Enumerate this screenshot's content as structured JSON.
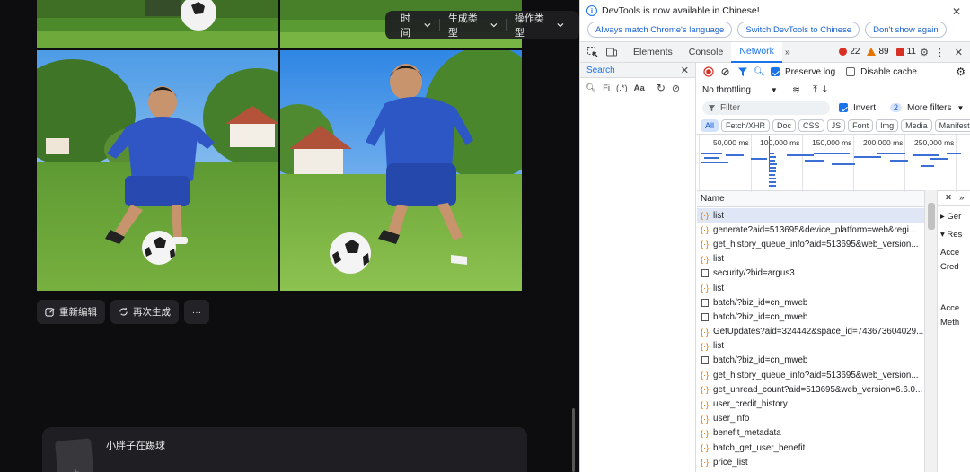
{
  "app": {
    "filters": [
      {
        "label": "时间"
      },
      {
        "label": "生成类型"
      },
      {
        "label": "操作类型"
      }
    ],
    "actions": {
      "reedit": "重新编辑",
      "regenerate": "再次生成",
      "more": "···"
    },
    "prompt": {
      "text": "小胖子在踢球",
      "thumb_plus": "+"
    }
  },
  "devtools": {
    "notice": {
      "text": "DevTools is now available in Chinese!",
      "buttons": [
        "Always match Chrome's language",
        "Switch DevTools to Chinese",
        "Don't show again"
      ],
      "close": "✕"
    },
    "tabs": [
      "Elements",
      "Console",
      "Network"
    ],
    "active_tab": "Network",
    "more_tabs": "»",
    "counts": {
      "errors": "22",
      "warnings": "89",
      "messages": "11"
    },
    "search_panel": {
      "title": "Search",
      "input_placeholder": "Fi",
      "regex": "(.*)",
      "case": "Aa"
    },
    "toolbar": {
      "preserve_log": "Preserve log",
      "disable_cache": "Disable cache",
      "throttling": "No throttling"
    },
    "filter": {
      "placeholder": "Filter",
      "invert": "Invert",
      "more_filters_count": "2",
      "more_filters": "More filters"
    },
    "types": [
      "All",
      "Fetch/XHR",
      "Doc",
      "CSS",
      "JS",
      "Font",
      "Img",
      "Media",
      "Manifest"
    ],
    "active_type": "All",
    "timeline": {
      "ticks": [
        "50,000 ms",
        "100,000 ms",
        "150,000 ms",
        "200,000 ms",
        "250,000 ms"
      ]
    },
    "requests": {
      "header": "Name",
      "items": [
        {
          "name": "list",
          "kind": "fetch"
        },
        {
          "name": "generate?aid=513695&device_platform=web&regi...",
          "kind": "fetch"
        },
        {
          "name": "get_history_queue_info?aid=513695&web_version...",
          "kind": "fetch"
        },
        {
          "name": "list",
          "kind": "fetch"
        },
        {
          "name": "security/?bid=argus3",
          "kind": "doc"
        },
        {
          "name": "list",
          "kind": "fetch"
        },
        {
          "name": "batch/?biz_id=cn_mweb",
          "kind": "doc"
        },
        {
          "name": "batch/?biz_id=cn_mweb",
          "kind": "doc"
        },
        {
          "name": "GetUpdates?aid=324442&space_id=743673604029...",
          "kind": "fetch"
        },
        {
          "name": "list",
          "kind": "fetch"
        },
        {
          "name": "batch/?biz_id=cn_mweb",
          "kind": "doc"
        },
        {
          "name": "get_history_queue_info?aid=513695&web_version...",
          "kind": "fetch"
        },
        {
          "name": "get_unread_count?aid=513695&web_version=6.6.0...",
          "kind": "fetch"
        },
        {
          "name": "user_credit_history",
          "kind": "fetch"
        },
        {
          "name": "user_info",
          "kind": "fetch"
        },
        {
          "name": "benefit_metadata",
          "kind": "fetch"
        },
        {
          "name": "batch_get_user_benefit",
          "kind": "fetch"
        },
        {
          "name": "price_list",
          "kind": "fetch"
        }
      ]
    },
    "detail": {
      "close": "✕",
      "more": "»",
      "general": "▸ Ger",
      "response": "▾ Res",
      "l1": "Acce",
      "l2": "Cred",
      "l3": "Acce",
      "l4": "Meth"
    }
  }
}
